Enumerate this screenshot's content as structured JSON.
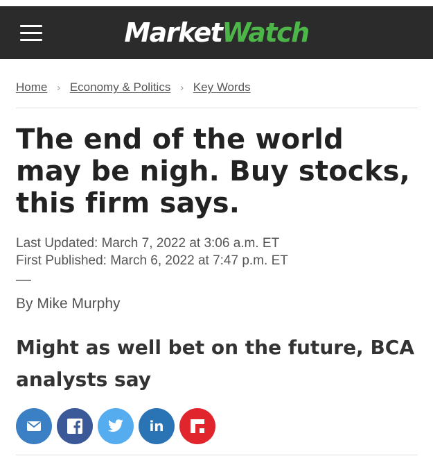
{
  "header": {
    "logo_part1": "Market",
    "logo_part2": "Watch",
    "brand_green": "#4cb648",
    "bg_color": "#2b2b2b"
  },
  "breadcrumb": {
    "items": [
      "Home",
      "Economy & Politics",
      "Key Words"
    ],
    "separator": "›"
  },
  "article": {
    "headline": "The end of the world may be nigh. Buy stocks, this firm says.",
    "last_updated": "Last Updated: March 7, 2022 at 3:06 a.m. ET",
    "first_published": "First Published: March 6, 2022 at 7:47 p.m. ET",
    "byline": "By Mike Murphy",
    "subheadline": "Might as well bet on the future, BCA analysts say"
  },
  "share": {
    "buttons": [
      {
        "icon": "email-icon",
        "color": "#3b7fc4"
      },
      {
        "icon": "facebook-icon",
        "color": "#3b5998"
      },
      {
        "icon": "twitter-icon",
        "color": "#55acee"
      },
      {
        "icon": "linkedin-icon",
        "color": "#2a73b5",
        "label": "in"
      },
      {
        "icon": "flipboard-icon",
        "color": "#e0262c"
      }
    ]
  }
}
